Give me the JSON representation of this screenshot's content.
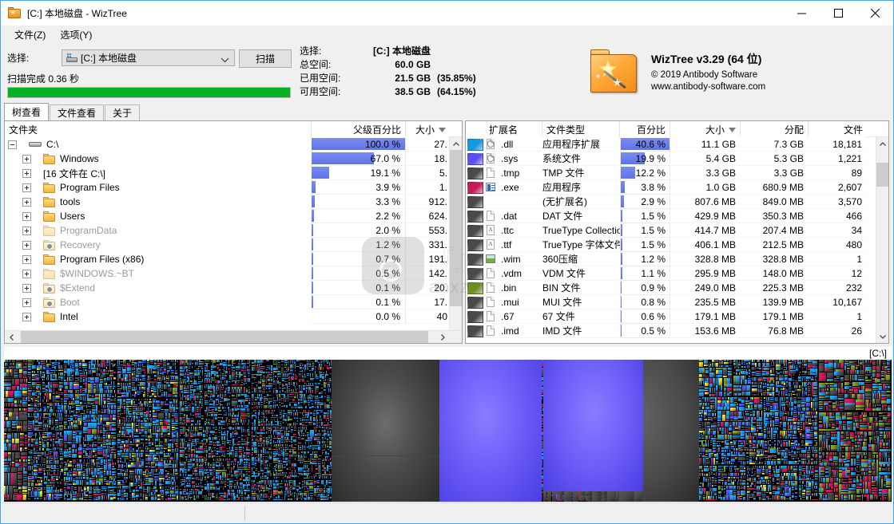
{
  "window": {
    "title": "[C:] 本地磁盘  -  WizTree",
    "icon": "wiztree-folder-icon",
    "minimize": "−",
    "maximize": "□",
    "close": "✕"
  },
  "menu": [
    {
      "label": "文件(Z)",
      "name": "menu-file"
    },
    {
      "label": "选项(Y)",
      "name": "menu-options"
    }
  ],
  "toolbar": {
    "select_label": "选择:",
    "drive_value": "[C:] 本地磁盘",
    "scan_button": "扫描",
    "scan_status": "扫描完成 0.36 秒",
    "progress_percent": 100,
    "progress_color": "#06b025"
  },
  "stats": {
    "rows": [
      {
        "label": "选择:",
        "value": "[C:] 本地磁盘",
        "extra": ""
      },
      {
        "label": "总空间:",
        "value": "60.0 GB",
        "extra": ""
      },
      {
        "label": "已用空间:",
        "value": "21.5 GB",
        "extra": "(35.85%)"
      },
      {
        "label": "可用空间:",
        "value": "38.5 GB",
        "extra": "(64.15%)"
      }
    ]
  },
  "brand": {
    "title": "WizTree v3.29 (64 位)",
    "copyright": "© 2019 Antibody Software",
    "website": "www.antibody-software.com"
  },
  "tabs": [
    {
      "label": "树查看",
      "name": "tab-tree-view",
      "active": true
    },
    {
      "label": "文件查看",
      "name": "tab-file-view",
      "active": false
    },
    {
      "label": "关于",
      "name": "tab-about",
      "active": false
    }
  ],
  "tree": {
    "headers": {
      "folder": "文件夹",
      "parent_percent": "父级百分比",
      "size": "大小"
    },
    "size_sorted": true,
    "rows": [
      {
        "name": "C:\\",
        "icon": "drive-icon",
        "depth": 0,
        "expander": "minus",
        "dim": false,
        "percent": "100.0 %",
        "bar": 100,
        "size": "27."
      },
      {
        "name": "Windows",
        "icon": "folder-icon",
        "depth": 1,
        "expander": "plus",
        "dim": false,
        "percent": "67.0 %",
        "bar": 67,
        "size": "18."
      },
      {
        "name": "[16 文件在 C:\\]",
        "icon": "none",
        "depth": 1,
        "expander": "plus",
        "dim": false,
        "percent": "19.1 %",
        "bar": 19.1,
        "size": "5."
      },
      {
        "name": "Program Files",
        "icon": "folder-icon",
        "depth": 1,
        "expander": "plus",
        "dim": false,
        "percent": "3.9 %",
        "bar": 3.9,
        "size": "1."
      },
      {
        "name": "tools",
        "icon": "folder-icon",
        "depth": 1,
        "expander": "plus",
        "dim": false,
        "percent": "3.3 %",
        "bar": 3.3,
        "size": "912."
      },
      {
        "name": "Users",
        "icon": "folder-icon",
        "depth": 1,
        "expander": "plus",
        "dim": false,
        "percent": "2.2 %",
        "bar": 2.2,
        "size": "624."
      },
      {
        "name": "ProgramData",
        "icon": "folder-icon",
        "depth": 1,
        "expander": "plus",
        "dim": true,
        "percent": "2.0 %",
        "bar": 2.0,
        "size": "553."
      },
      {
        "name": "Recovery",
        "icon": "gear-folder-icon",
        "depth": 1,
        "expander": "plus",
        "dim": true,
        "percent": "1.2 %",
        "bar": 1.2,
        "size": "331."
      },
      {
        "name": "Program Files (x86)",
        "icon": "folder-icon",
        "depth": 1,
        "expander": "plus",
        "dim": false,
        "percent": "0.7 %",
        "bar": 0.7,
        "size": "191."
      },
      {
        "name": "$WINDOWS.~BT",
        "icon": "folder-icon",
        "depth": 1,
        "expander": "plus",
        "dim": true,
        "percent": "0.5 %",
        "bar": 0.5,
        "size": "142."
      },
      {
        "name": "$Extend",
        "icon": "gear-folder-icon",
        "depth": 1,
        "expander": "plus",
        "dim": true,
        "percent": "0.1 %",
        "bar": 0.1,
        "size": "20."
      },
      {
        "name": "Boot",
        "icon": "gear-folder-icon",
        "depth": 1,
        "expander": "plus",
        "dim": true,
        "percent": "0.1 %",
        "bar": 0.1,
        "size": "17."
      },
      {
        "name": "Intel",
        "icon": "folder-icon",
        "depth": 1,
        "expander": "plus",
        "dim": false,
        "percent": "0.0 %",
        "bar": 0.0,
        "size": "40"
      }
    ]
  },
  "filetypes": {
    "headers": {
      "extension": "扩展名",
      "filetype": "文件类型",
      "percent": "百分比",
      "size": "大小",
      "allocated": "分配",
      "files": "文件"
    },
    "size_sorted": true,
    "rows": [
      {
        "color": "#0e9ae8",
        "ext": ".dll",
        "icon": "clip-icon",
        "type": "应用程序扩展",
        "percent": "40.6 %",
        "bar": 100,
        "size": "11.1 GB",
        "allocated": "7.3 GB",
        "files": "18,181"
      },
      {
        "color": "#5a4ef5",
        "ext": ".sys",
        "icon": "clip-icon",
        "type": "系统文件",
        "percent": "19.9 %",
        "bar": 49,
        "size": "5.4 GB",
        "allocated": "5.3 GB",
        "files": "1,221"
      },
      {
        "color": "#4a4a4a",
        "ext": ".tmp",
        "icon": "page-icon",
        "type": "TMP 文件",
        "percent": "12.2 %",
        "bar": 30,
        "size": "3.3 GB",
        "allocated": "3.3 GB",
        "files": "89"
      },
      {
        "color": "#c81a5a",
        "ext": ".exe",
        "icon": "exe-icon",
        "type": "应用程序",
        "percent": "3.8 %",
        "bar": 9,
        "size": "1.0 GB",
        "allocated": "680.9 MB",
        "files": "2,607"
      },
      {
        "color": "#4a4a4a",
        "ext": "",
        "icon": "none",
        "type": "(无扩展名)",
        "percent": "2.9 %",
        "bar": 7,
        "size": "807.6 MB",
        "allocated": "849.0 MB",
        "files": "3,570"
      },
      {
        "color": "#4a4a4a",
        "ext": ".dat",
        "icon": "page-icon",
        "type": "DAT 文件",
        "percent": "1.5 %",
        "bar": 4,
        "size": "429.9 MB",
        "allocated": "350.3 MB",
        "files": "466"
      },
      {
        "color": "#4a4a4a",
        "ext": ".ttc",
        "icon": "font-icon",
        "type": "TrueType Collectio",
        "percent": "1.5 %",
        "bar": 4,
        "size": "414.7 MB",
        "allocated": "207.4 MB",
        "files": "34"
      },
      {
        "color": "#4a4a4a",
        "ext": ".ttf",
        "icon": "font-icon",
        "type": "TrueType 字体文件",
        "percent": "1.5 %",
        "bar": 4,
        "size": "406.1 MB",
        "allocated": "212.5 MB",
        "files": "480"
      },
      {
        "color": "#4a4a4a",
        "ext": ".wim",
        "icon": "image-icon",
        "type": "360压缩",
        "percent": "1.2 %",
        "bar": 3,
        "size": "328.8 MB",
        "allocated": "328.8 MB",
        "files": "1"
      },
      {
        "color": "#4a4a4a",
        "ext": ".vdm",
        "icon": "page-icon",
        "type": "VDM 文件",
        "percent": "1.1 %",
        "bar": 3,
        "size": "295.9 MB",
        "allocated": "148.0 MB",
        "files": "12"
      },
      {
        "color": "#6e8f1e",
        "ext": ".bin",
        "icon": "page-icon",
        "type": "BIN 文件",
        "percent": "0.9 %",
        "bar": 2,
        "size": "249.0 MB",
        "allocated": "225.3 MB",
        "files": "232"
      },
      {
        "color": "#4a4a4a",
        "ext": ".mui",
        "icon": "page-icon",
        "type": "MUI 文件",
        "percent": "0.8 %",
        "bar": 2,
        "size": "235.5 MB",
        "allocated": "139.9 MB",
        "files": "10,167"
      },
      {
        "color": "#4a4a4a",
        "ext": ".67",
        "icon": "page-icon",
        "type": "67 文件",
        "percent": "0.6 %",
        "bar": 2,
        "size": "179.1 MB",
        "allocated": "179.1 MB",
        "files": "1"
      },
      {
        "color": "#4a4a4a",
        "ext": ".imd",
        "icon": "page-icon",
        "type": "IMD 文件",
        "percent": "0.5 %",
        "bar": 1,
        "size": "153.6 MB",
        "allocated": "76.8 MB",
        "files": "26"
      }
    ]
  },
  "treemap": {
    "label": "[C:\\]",
    "palette": {
      "dll": "#1d9be8",
      "sys": "#5a4ef5",
      "exe": "#c81a5a",
      "other": "#4a4a4a",
      "bin": "#7f9a22",
      "wim": "#e07a14",
      "yellow": "#ded32a"
    }
  },
  "watermark": {
    "text": "anxz",
    "suffix": ".com"
  }
}
